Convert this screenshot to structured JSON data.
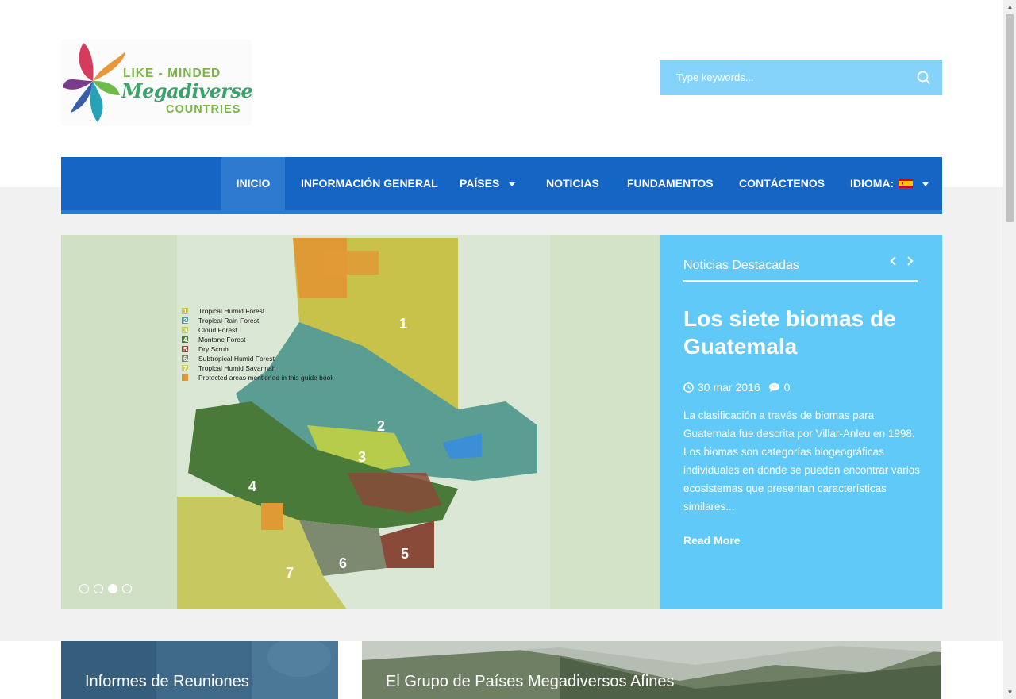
{
  "logo": {
    "line1": "LIKE - MINDED",
    "line2": "Megadiverse",
    "line3": "COUNTRIES",
    "icon": "flower-pinwheel-icon"
  },
  "search": {
    "placeholder": "Type keywords...",
    "icon": "search-icon"
  },
  "nav": {
    "items": [
      {
        "label": "INICIO",
        "active": true
      },
      {
        "label": "INFORMACIÓN GENERAL"
      },
      {
        "label": "PAÍSES",
        "dropdown": true
      },
      {
        "label": "NOTICIAS"
      },
      {
        "label": "FUNDAMENTOS"
      },
      {
        "label": "CONTÁCTENOS"
      },
      {
        "label": "IDIOMA:",
        "dropdown": true,
        "icon": "spain-flag-icon"
      }
    ],
    "color": "#1565c5"
  },
  "slider": {
    "legend": [
      {
        "num": "1.",
        "label": "Tropical Humid Forest",
        "color": "#c9c24a"
      },
      {
        "num": "2.",
        "label": "Tropical Rain Forest",
        "color": "#5a9e93"
      },
      {
        "num": "3.",
        "label": "Cloud Forest",
        "color": "#b6cc4a"
      },
      {
        "num": "4.",
        "label": "Montane Forest",
        "color": "#4a7a3a"
      },
      {
        "num": "5.",
        "label": "Dry Scrub",
        "color": "#8a4a3a"
      },
      {
        "num": "6.",
        "label": "Subtropical Humid Forest",
        "color": "#7d8a70"
      },
      {
        "num": "7.",
        "label": "Tropical Humid Savannah",
        "color": "#c8c860"
      },
      {
        "num": "",
        "label": "Protected areas mentioned in this guide book",
        "color": "#e09a35"
      }
    ],
    "map_numbers": [
      "1",
      "2",
      "3",
      "4",
      "5",
      "6",
      "7"
    ],
    "dots": 4,
    "active_dot": 3
  },
  "featured": {
    "heading": "Noticias Destacadas",
    "title": "Los siete biomas de Guatemala",
    "date": "30 mar 2016",
    "comments": "0",
    "excerpt": "La clasificación a través de biomas para Guatemala fue descrita por Villar-Anleu en 1998. Los biomas son categorías biogeográficas individuales en donde se pueden encontrar varios ecosistemas que presentan características similares...",
    "read_more": "Read More",
    "color": "#61c9f8"
  },
  "cards": [
    {
      "title": "Informes de Reuniones"
    },
    {
      "title": "El Grupo de Países Megadiversos Afines"
    }
  ]
}
